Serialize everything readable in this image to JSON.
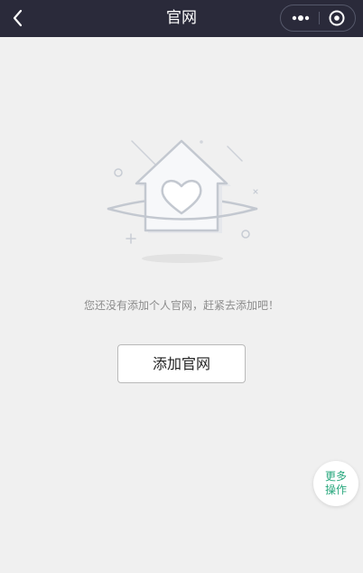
{
  "nav": {
    "title": "官网",
    "back_icon": "chevron-left-icon",
    "more_icon": "more-dots-icon",
    "close_icon": "target-circle-icon",
    "background": "#2a2a3a"
  },
  "empty_state": {
    "illustration": "house-heart-illustration",
    "message": "您还没有添加个人官网，赶紧去添加吧！",
    "add_button_label": "添加官网"
  },
  "floating": {
    "more_ops_line1": "更多",
    "more_ops_line2": "操作",
    "accent": "#28a77d"
  }
}
